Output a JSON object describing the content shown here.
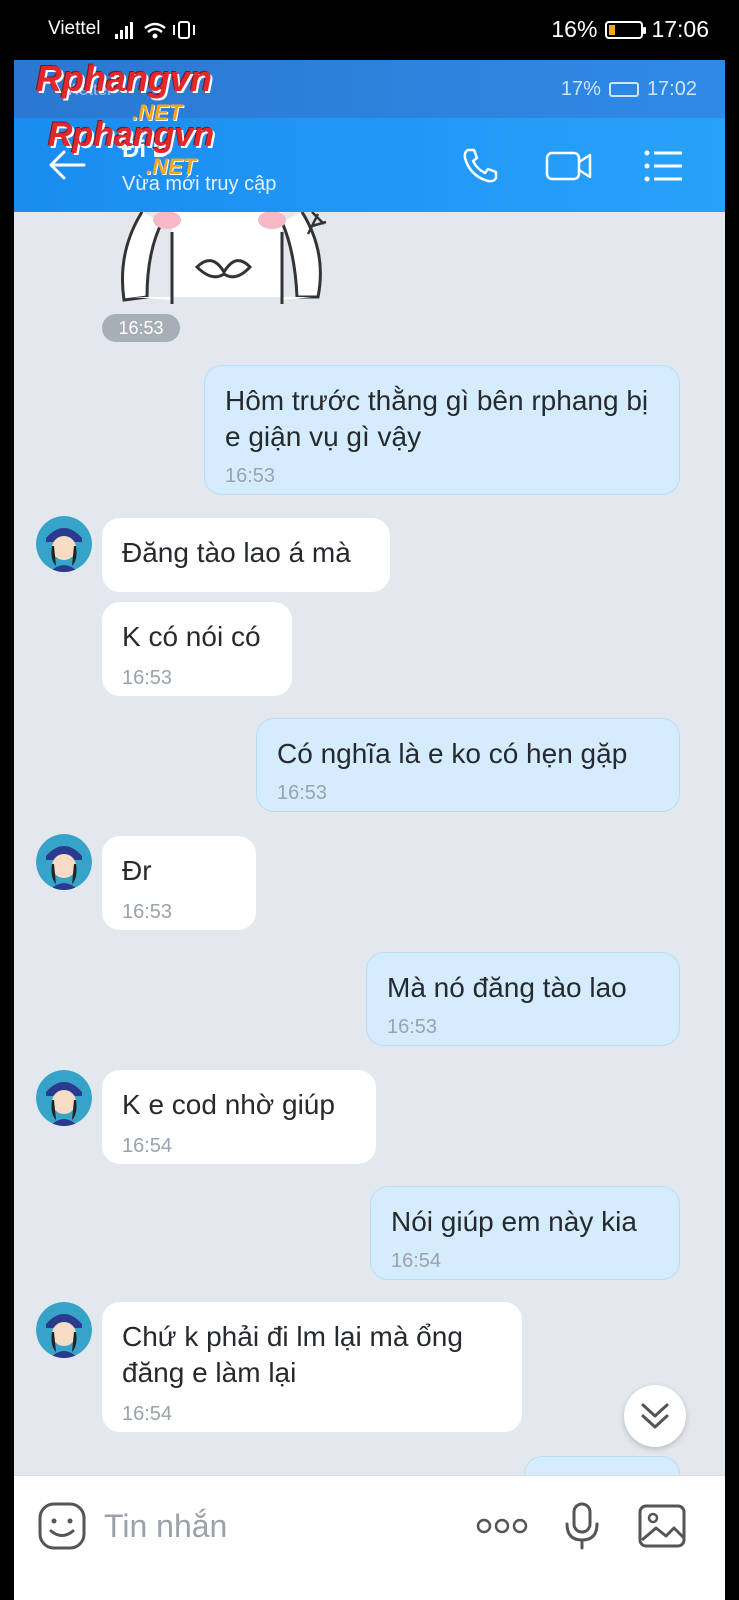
{
  "outer_status": {
    "carrier": "Viettel",
    "battery": "16%",
    "time": "17:06"
  },
  "inner_status": {
    "carrier": "Viettel",
    "battery": "17%",
    "time": "17:02"
  },
  "watermark": {
    "brand": "Rphangvn",
    "suffix": ".NET"
  },
  "header": {
    "title": "Đi Đ",
    "subtitle": "Vừa mới truy cập"
  },
  "sticker_time": "16:53",
  "messages": [
    {
      "from": "me",
      "text": "Hôm trước thằng gì bên rphang bị e giận vụ gì vậy",
      "time": "16:53"
    },
    {
      "from": "them",
      "text": "Đăng tào lao á mà",
      "time": ""
    },
    {
      "from": "them",
      "text": "K có nói có",
      "time": "16:53"
    },
    {
      "from": "me",
      "text": "Có nghĩa là e ko có hẹn gặp",
      "time": "16:53"
    },
    {
      "from": "them",
      "text": "Đr",
      "time": "16:53"
    },
    {
      "from": "me",
      "text": "Mà nó đăng tào lao",
      "time": "16:53"
    },
    {
      "from": "them",
      "text": "K e cod nhờ giúp",
      "time": "16:54"
    },
    {
      "from": "me",
      "text": "Nói giúp em này kia",
      "time": "16:54"
    },
    {
      "from": "them",
      "text": "Chứ k phải đi lm lại mà ổng đăng e làm lại",
      "time": "16:54"
    }
  ],
  "composer": {
    "placeholder": "Tin nhắn"
  },
  "colors": {
    "header": "#1a8cf0",
    "my_bubble": "#d4ecfe",
    "their_bubble": "#ffffff",
    "background": "#e3e8ee"
  }
}
